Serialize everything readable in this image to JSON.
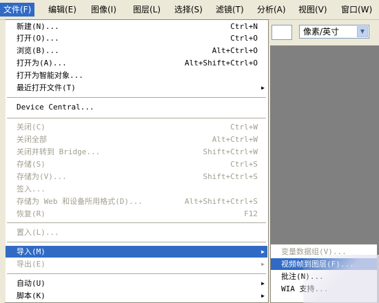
{
  "menubar": [
    {
      "label": "文件(F)",
      "active": true
    },
    {
      "label": "编辑(E)"
    },
    {
      "label": "图像(I)"
    },
    {
      "label": "图层(L)"
    },
    {
      "label": "选择(S)"
    },
    {
      "label": "滤镜(T)"
    },
    {
      "label": "分析(A)"
    },
    {
      "label": "视图(V)"
    },
    {
      "label": "窗口(W)"
    }
  ],
  "options": {
    "unit_select": "像素/英寸"
  },
  "file_menu": {
    "new": {
      "label": "新建(N)...",
      "shortcut": "Ctrl+N"
    },
    "open": {
      "label": "打开(O)...",
      "shortcut": "Ctrl+O"
    },
    "browse": {
      "label": "浏览(B)...",
      "shortcut": "Alt+Ctrl+O"
    },
    "open_as": {
      "label": "打开为(A)...",
      "shortcut": "Alt+Shift+Ctrl+O"
    },
    "open_smart": {
      "label": "打开为智能对象..."
    },
    "recent": {
      "label": "最近打开文件(T)"
    },
    "device_central": {
      "label": "Device Central..."
    },
    "close": {
      "label": "关闭(C)",
      "shortcut": "Ctrl+W"
    },
    "close_all": {
      "label": "关闭全部",
      "shortcut": "Alt+Ctrl+W"
    },
    "close_bridge": {
      "label": "关闭并转到 Bridge...",
      "shortcut": "Shift+Ctrl+W"
    },
    "save": {
      "label": "存储(S)",
      "shortcut": "Ctrl+S"
    },
    "save_as": {
      "label": "存储为(V)...",
      "shortcut": "Shift+Ctrl+S"
    },
    "check_in": {
      "label": "签入..."
    },
    "save_web": {
      "label": "存储为 Web 和设备所用格式(D)...",
      "shortcut": "Alt+Shift+Ctrl+S"
    },
    "revert": {
      "label": "恢复(R)",
      "shortcut": "F12"
    },
    "place": {
      "label": "置入(L)..."
    },
    "import": {
      "label": "导入(M)"
    },
    "export": {
      "label": "导出(E)"
    },
    "automate": {
      "label": "自动(U)"
    },
    "scripts": {
      "label": "脚本(K)"
    }
  },
  "import_submenu": [
    {
      "label": "变量数据组(V)...",
      "disabled": true
    },
    {
      "label": "视频帧到图层(F)...",
      "highlighted": true
    },
    {
      "label": "批注(N)..."
    },
    {
      "label": "WIA 支持..."
    }
  ]
}
